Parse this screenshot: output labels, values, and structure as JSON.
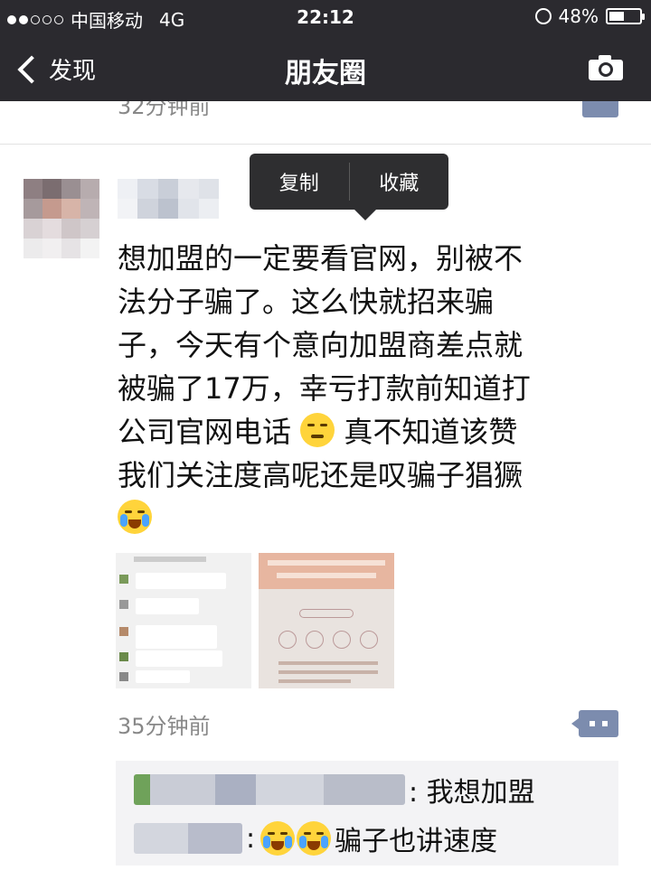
{
  "status_bar": {
    "carrier": "中国移动",
    "network": "4G",
    "time": "22:12",
    "battery": "48%"
  },
  "nav": {
    "back_label": "发现",
    "title": "朋友圈"
  },
  "previous_post": {
    "time_fragment": "32分钟前"
  },
  "context_menu": {
    "copy": "复制",
    "favorite": "收藏"
  },
  "post": {
    "lines": [
      "想加盟的一定要看官网，别被不",
      "法分子骗了。这么快就招来骗",
      "子，今天有个意向加盟商差点就",
      "被骗了17万，幸亏打款前知道打",
      "公司官网电话",
      " 真不知道该赞",
      "我们关注度高呢还是叹骗子猖獗"
    ],
    "time_ago": "35分钟前"
  },
  "comments": [
    {
      "text": ": 我想加盟"
    },
    {
      "text": "骗子也讲速度"
    }
  ],
  "colors": {
    "nav_bg": "#2b2a2f",
    "link_blue": "#7c8cae"
  }
}
